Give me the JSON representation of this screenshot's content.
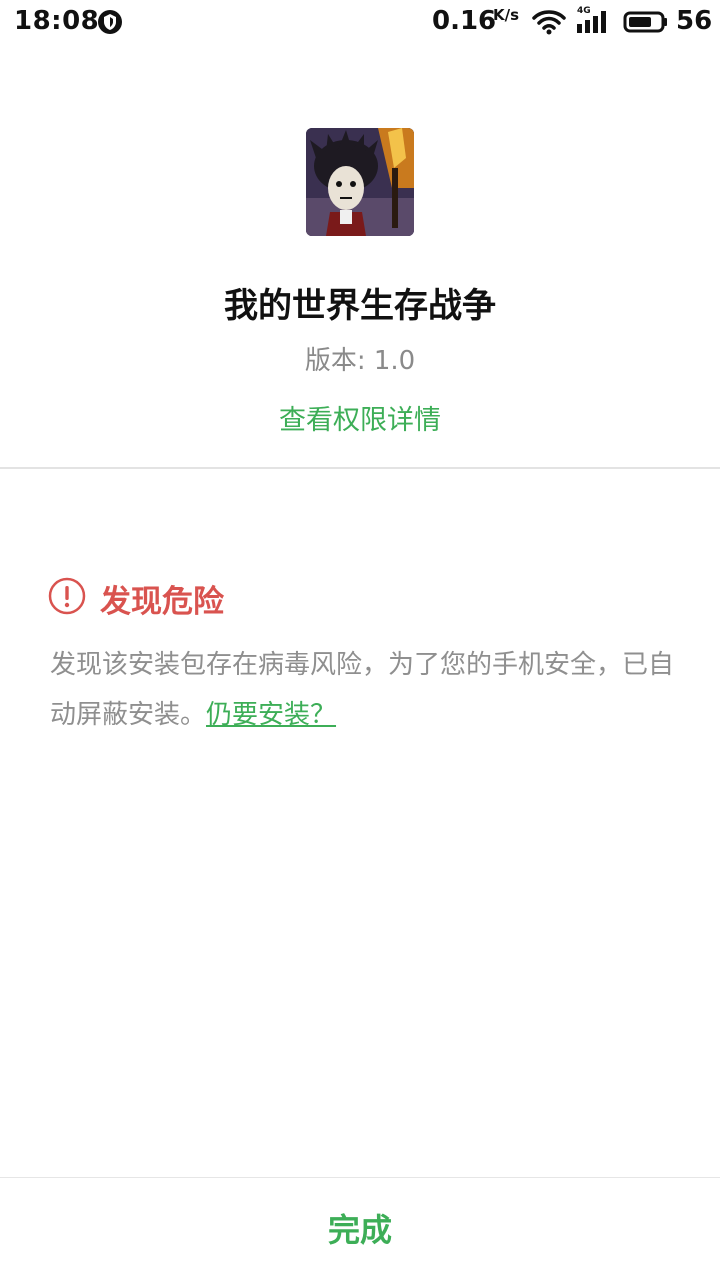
{
  "status_bar": {
    "time": "18:08",
    "net_speed": "0.16",
    "net_speed_unit": "K/s",
    "network_type": "4G",
    "battery_level": "56"
  },
  "app": {
    "name": "我的世界生存战争",
    "version": "版本: 1.0",
    "permissions_link": "查看权限详情"
  },
  "warning": {
    "title": "发现危险",
    "message": "发现该安装包存在病毒风险，为了您的手机安全，已自动屏蔽安装。",
    "install_anyway_link": "仍要安装？"
  },
  "footer": {
    "done_label": "完成"
  },
  "colors": {
    "accent_green": "#3dae57",
    "danger_red": "#d9534f",
    "muted_text": "#8f8f8f"
  },
  "icons": {
    "notification": "vpn-shield-icon",
    "wifi": "wifi-icon",
    "signal": "cellular-signal-icon",
    "battery": "battery-icon",
    "warning": "exclamation-circle-icon"
  }
}
